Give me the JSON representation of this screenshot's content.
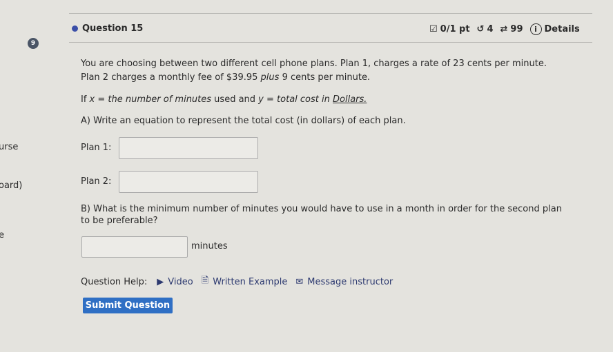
{
  "sidebar": {
    "fragments": [
      "urse",
      "oard)",
      "e"
    ],
    "badge": "9"
  },
  "header": {
    "title": "Question 15",
    "score": "0/1 pt",
    "retries": "4",
    "attempts": "99",
    "details": "Details"
  },
  "question": {
    "intro_line1": "You are choosing between two different cell phone plans. Plan 1, charges a rate of 23 cents per minute.",
    "intro_line2_a": "Plan 2 charges a monthly fee of $39.95 ",
    "intro_line2_plus": "plus",
    "intro_line2_b": " 9 cents per minute.",
    "if": "If ",
    "x": "x",
    "eq1": " = ",
    "xdef": "the number of minutes",
    "used": " used and ",
    "y": "y",
    "eq2": " = ",
    "ydef": "total cost in ",
    "ydollars": "Dollars.",
    "partA": "A) Write an equation to represent the total cost (in dollars) of each plan.",
    "plan1": "Plan 1:",
    "plan2": "Plan 2:",
    "partB_line1": "B) What is the minimum number of minutes you would have to use in a month in order for the second plan",
    "partB_line2": "to be preferable?",
    "units": "minutes"
  },
  "help": {
    "label": "Question Help:",
    "video": "Video",
    "written": "Written Example",
    "message": "Message instructor"
  },
  "submit": "Submit Question"
}
